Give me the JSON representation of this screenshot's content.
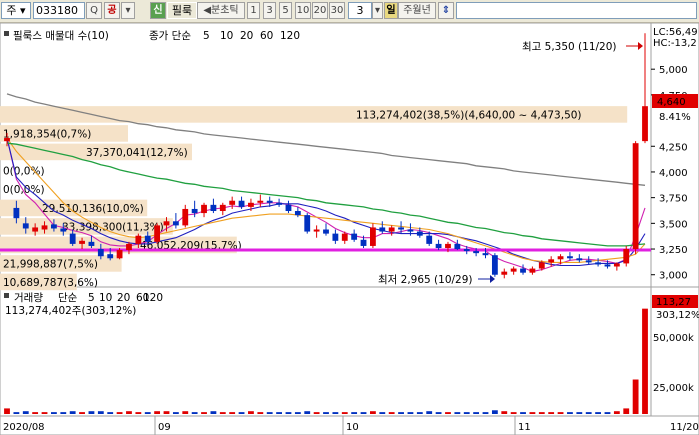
{
  "toolbar": {
    "market": "주",
    "code": "033180",
    "search_btn": "Q",
    "gong_btn": "공",
    "shin_btn": "신",
    "name": "필룩",
    "tf_label": "◀분초틱",
    "periods": [
      "1",
      "3",
      "5",
      "10",
      "20",
      "30"
    ],
    "custom_period": "3",
    "ilju": "일",
    "juwol": "주월년",
    "nav": "⇕"
  },
  "price_panel": {
    "legend_title": "필룩스 매물대 수(10)",
    "legend_ma_prefix": "종가 단순",
    "ma_periods": [
      "5",
      "10",
      "20",
      "60",
      "120"
    ],
    "ma_colors": [
      "#d020b0",
      "#2020c0",
      "#f0a020",
      "#20a040",
      "#808080"
    ],
    "lc_label": "LC:56,49",
    "hc_label": "HC:-13,2",
    "max_label": "최고 5,350 (11/20)",
    "min_label": "최저 2,965 (10/29)",
    "current_price": "4,640",
    "current_change": "8.41%",
    "volume_profile": [
      {
        "label": "113,274,402(38,5%)(4,640,00 ~ 4,473,50)",
        "price": 4560,
        "frac": 0.98
      },
      {
        "label": "1,918,354(0,7%)",
        "price": 4375,
        "frac": 0.2
      },
      {
        "label": "37,370,041(12,7%)",
        "price": 4195,
        "frac": 0.3
      },
      {
        "label": "0(0,0%)",
        "price": 4015,
        "frac": 0.0
      },
      {
        "label": "0(0,0%)",
        "price": 3835,
        "frac": 0.0
      },
      {
        "label": "29,510,136(10,0%)",
        "price": 3650,
        "frac": 0.23
      },
      {
        "label": "33,398,300(11,3%)",
        "price": 3470,
        "frac": 0.27
      },
      {
        "label": "46,052,209(15,7%)",
        "price": 3290,
        "frac": 0.37
      },
      {
        "label": "21,998,887(7,5%)",
        "price": 3110,
        "frac": 0.19
      },
      {
        "label": "10,689,787(3,6%)",
        "price": 2930,
        "frac": 0.12
      }
    ],
    "y_ticks": [
      "5,000",
      "4,750",
      "4,250",
      "4,000",
      "3,750",
      "3,500",
      "3,250",
      "3,000"
    ]
  },
  "volume_panel": {
    "legend_title": "거래량",
    "legend_ma_prefix": "단순",
    "ma_periods": [
      "5",
      "10",
      "20",
      "60",
      "120"
    ],
    "ma_colors": [
      "#d020b0",
      "#2020c0",
      "#f0a020",
      "#20a040",
      "#808080"
    ],
    "summary": "113,274,402주(303,12%)",
    "last_volume": "113,27",
    "change_label": "303,12%",
    "y_ticks": [
      "50,000k",
      "25,000k"
    ]
  },
  "x_axis": [
    "2020/08",
    "09",
    "10",
    "11",
    "11/20"
  ],
  "chart_data": {
    "type": "candlestick",
    "candles": [
      [
        4300,
        4380,
        4250,
        4330
      ],
      [
        3650,
        3720,
        3500,
        3550
      ],
      [
        3500,
        3560,
        3400,
        3450
      ],
      [
        3420,
        3500,
        3380,
        3460
      ],
      [
        3440,
        3520,
        3400,
        3480
      ],
      [
        3490,
        3540,
        3420,
        3450
      ],
      [
        3450,
        3500,
        3380,
        3420
      ],
      [
        3400,
        3440,
        3280,
        3300
      ],
      [
        3300,
        3360,
        3250,
        3330
      ],
      [
        3320,
        3380,
        3260,
        3280
      ],
      [
        3250,
        3300,
        3150,
        3180
      ],
      [
        3200,
        3260,
        3140,
        3160
      ],
      [
        3160,
        3260,
        3150,
        3240
      ],
      [
        3240,
        3320,
        3200,
        3300
      ],
      [
        3300,
        3400,
        3260,
        3380
      ],
      [
        3380,
        3420,
        3300,
        3320
      ],
      [
        3320,
        3500,
        3300,
        3480
      ],
      [
        3480,
        3560,
        3420,
        3520
      ],
      [
        3520,
        3600,
        3450,
        3480
      ],
      [
        3480,
        3680,
        3460,
        3640
      ],
      [
        3640,
        3720,
        3560,
        3600
      ],
      [
        3600,
        3700,
        3560,
        3680
      ],
      [
        3680,
        3740,
        3600,
        3620
      ],
      [
        3620,
        3700,
        3580,
        3680
      ],
      [
        3680,
        3760,
        3640,
        3720
      ],
      [
        3720,
        3760,
        3640,
        3660
      ],
      [
        3660,
        3740,
        3620,
        3700
      ],
      [
        3700,
        3780,
        3660,
        3720
      ],
      [
        3720,
        3760,
        3660,
        3700
      ],
      [
        3700,
        3740,
        3660,
        3680
      ],
      [
        3680,
        3720,
        3600,
        3620
      ],
      [
        3620,
        3660,
        3560,
        3580
      ],
      [
        3580,
        3600,
        3400,
        3420
      ],
      [
        3420,
        3480,
        3360,
        3440
      ],
      [
        3440,
        3500,
        3380,
        3400
      ],
      [
        3400,
        3440,
        3300,
        3330
      ],
      [
        3330,
        3420,
        3300,
        3400
      ],
      [
        3400,
        3440,
        3320,
        3340
      ],
      [
        3340,
        3380,
        3260,
        3280
      ],
      [
        3280,
        3500,
        3260,
        3460
      ],
      [
        3460,
        3520,
        3400,
        3420
      ],
      [
        3420,
        3480,
        3380,
        3460
      ],
      [
        3460,
        3520,
        3400,
        3440
      ],
      [
        3440,
        3500,
        3380,
        3420
      ],
      [
        3420,
        3460,
        3360,
        3380
      ],
      [
        3380,
        3420,
        3280,
        3300
      ],
      [
        3300,
        3340,
        3240,
        3260
      ],
      [
        3260,
        3320,
        3220,
        3300
      ],
      [
        3300,
        3340,
        3240,
        3250
      ],
      [
        3250,
        3280,
        3200,
        3230
      ],
      [
        3230,
        3260,
        3180,
        3210
      ],
      [
        3210,
        3260,
        3160,
        3190
      ],
      [
        3190,
        3210,
        2980,
        3000
      ],
      [
        3000,
        3060,
        2965,
        3030
      ],
      [
        3030,
        3080,
        3000,
        3060
      ],
      [
        3060,
        3100,
        3000,
        3020
      ],
      [
        3020,
        3080,
        3000,
        3060
      ],
      [
        3060,
        3140,
        3040,
        3120
      ],
      [
        3120,
        3180,
        3080,
        3150
      ],
      [
        3150,
        3200,
        3100,
        3180
      ],
      [
        3180,
        3220,
        3140,
        3160
      ],
      [
        3160,
        3200,
        3120,
        3140
      ],
      [
        3140,
        3180,
        3100,
        3120
      ],
      [
        3120,
        3160,
        3080,
        3100
      ],
      [
        3100,
        3140,
        3060,
        3080
      ],
      [
        3080,
        3120,
        3040,
        3110
      ],
      [
        3110,
        3280,
        3080,
        3250
      ],
      [
        3250,
        4300,
        3200,
        4280
      ],
      [
        4300,
        5350,
        4280,
        4640
      ]
    ],
    "volumes": [
      6,
      2,
      3,
      2,
      2,
      2,
      2,
      3,
      2,
      3,
      3,
      2,
      2,
      3,
      2,
      2,
      3,
      3,
      2,
      3,
      2,
      2,
      3,
      2,
      2,
      2,
      3,
      2,
      2,
      2,
      2,
      2,
      3,
      2,
      2,
      2,
      2,
      2,
      2,
      3,
      2,
      2,
      2,
      2,
      2,
      3,
      2,
      2,
      2,
      2,
      2,
      2,
      4,
      3,
      2,
      2,
      2,
      2,
      2,
      2,
      2,
      2,
      2,
      2,
      2,
      3,
      6,
      37,
      113
    ],
    "price_ylim": [
      2900,
      5430
    ],
    "volume_ylim": [
      0,
      118
    ],
    "volume_unit": "백만주",
    "series": [
      {
        "name": "5",
        "values": [
          4330,
          3930,
          3780,
          3700,
          3590,
          3480,
          3460,
          3430,
          3410,
          3380,
          3320,
          3290,
          3280,
          3280,
          3300,
          3320,
          3390,
          3450,
          3500,
          3580,
          3590,
          3620,
          3640,
          3650,
          3670,
          3660,
          3680,
          3690,
          3700,
          3700,
          3680,
          3660,
          3610,
          3560,
          3510,
          3450,
          3410,
          3380,
          3360,
          3360,
          3400,
          3400,
          3420,
          3440,
          3430,
          3410,
          3380,
          3350,
          3300,
          3270,
          3250,
          3230,
          3170,
          3130,
          3100,
          3070,
          3030,
          3050,
          3080,
          3110,
          3140,
          3150,
          3150,
          3140,
          3130,
          3110,
          3150,
          3380,
          3650
        ]
      },
      {
        "name": "10",
        "values": [
          4330,
          3950,
          3850,
          3780,
          3700,
          3620,
          3580,
          3530,
          3490,
          3450,
          3400,
          3360,
          3330,
          3310,
          3300,
          3300,
          3320,
          3340,
          3360,
          3400,
          3440,
          3490,
          3530,
          3560,
          3600,
          3620,
          3640,
          3660,
          3670,
          3690,
          3690,
          3690,
          3670,
          3650,
          3620,
          3580,
          3550,
          3510,
          3480,
          3450,
          3430,
          3410,
          3400,
          3400,
          3400,
          3400,
          3400,
          3390,
          3370,
          3350,
          3330,
          3300,
          3270,
          3240,
          3200,
          3170,
          3140,
          3120,
          3100,
          3090,
          3090,
          3090,
          3100,
          3110,
          3110,
          3110,
          3140,
          3250,
          3400
        ]
      },
      {
        "name": "20",
        "values": [
          4330,
          4200,
          4100,
          4000,
          3900,
          3800,
          3700,
          3620,
          3560,
          3510,
          3460,
          3420,
          3390,
          3370,
          3360,
          3370,
          3390,
          3410,
          3430,
          3450,
          3470,
          3490,
          3510,
          3530,
          3550,
          3560,
          3570,
          3580,
          3590,
          3590,
          3590,
          3580,
          3570,
          3560,
          3550,
          3540,
          3530,
          3520,
          3510,
          3500,
          3490,
          3480,
          3470,
          3460,
          3450,
          3440,
          3420,
          3400,
          3370,
          3340,
          3310,
          3280,
          3250,
          3220,
          3190,
          3160,
          3140,
          3130,
          3120,
          3120,
          3120,
          3120,
          3130,
          3140,
          3150,
          3160,
          3170,
          3200,
          3300
        ]
      },
      {
        "name": "60",
        "values": [
          4280,
          4270,
          4250,
          4230,
          4210,
          4190,
          4170,
          4150,
          4120,
          4100,
          4070,
          4050,
          4020,
          4000,
          3980,
          3960,
          3940,
          3930,
          3910,
          3890,
          3880,
          3860,
          3850,
          3840,
          3820,
          3810,
          3800,
          3790,
          3780,
          3770,
          3760,
          3750,
          3730,
          3720,
          3700,
          3690,
          3680,
          3670,
          3660,
          3640,
          3630,
          3610,
          3600,
          3580,
          3570,
          3550,
          3530,
          3510,
          3500,
          3480,
          3460,
          3450,
          3430,
          3410,
          3400,
          3380,
          3370,
          3350,
          3340,
          3330,
          3320,
          3310,
          3300,
          3290,
          3280,
          3280,
          3280,
          3290,
          3300
        ]
      },
      {
        "name": "120",
        "values": [
          4760,
          4730,
          4710,
          4680,
          4660,
          4640,
          4620,
          4600,
          4580,
          4560,
          4540,
          4520,
          4500,
          4490,
          4470,
          4460,
          4440,
          4430,
          4410,
          4400,
          4390,
          4370,
          4360,
          4350,
          4340,
          4330,
          4320,
          4310,
          4300,
          4290,
          4280,
          4270,
          4260,
          4250,
          4240,
          4230,
          4220,
          4210,
          4200,
          4190,
          4180,
          4160,
          4150,
          4140,
          4130,
          4120,
          4110,
          4100,
          4090,
          4080,
          4060,
          4050,
          4040,
          4030,
          4010,
          4000,
          3990,
          3980,
          3970,
          3960,
          3950,
          3940,
          3930,
          3920,
          3910,
          3900,
          3890,
          3880,
          3870
        ]
      }
    ]
  }
}
